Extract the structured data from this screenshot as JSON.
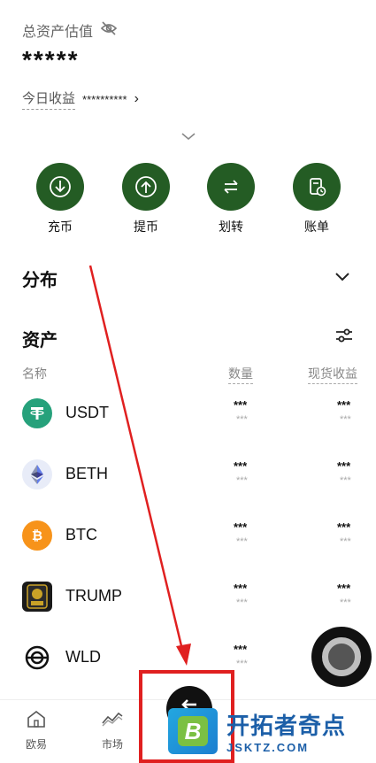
{
  "header": {
    "total_label": "总资产估值",
    "masked_value": "*****",
    "today_label": "今日收益",
    "today_masked": "**********",
    "today_chevron": "›"
  },
  "actions": [
    {
      "label": "充币",
      "icon": "deposit-icon"
    },
    {
      "label": "提币",
      "icon": "withdraw-icon"
    },
    {
      "label": "划转",
      "icon": "transfer-icon"
    },
    {
      "label": "账单",
      "icon": "bill-icon"
    }
  ],
  "distribution": {
    "title": "分布"
  },
  "assets": {
    "title": "资产",
    "columns": {
      "name": "名称",
      "quantity": "数量",
      "spot_pnl": "现货收益"
    },
    "rows": [
      {
        "name": "USDT",
        "qty": "***",
        "qty_sub": "***",
        "pnl": "***",
        "pnl_sub": "***",
        "color": "#26a17b"
      },
      {
        "name": "BETH",
        "qty": "***",
        "qty_sub": "***",
        "pnl": "***",
        "pnl_sub": "***",
        "color": "#e8ecf8"
      },
      {
        "name": "BTC",
        "qty": "***",
        "qty_sub": "***",
        "pnl": "***",
        "pnl_sub": "***",
        "color": "#f7931a"
      },
      {
        "name": "TRUMP",
        "qty": "***",
        "qty_sub": "***",
        "pnl": "***",
        "pnl_sub": "***",
        "color": "#1a1a1a"
      },
      {
        "name": "WLD",
        "qty": "***",
        "qty_sub": "***",
        "pnl": "***",
        "pnl_sub": "***",
        "color": "#ffffff"
      }
    ]
  },
  "tabbar": {
    "tabs": [
      {
        "label": "欧易",
        "icon": "home-icon"
      },
      {
        "label": "市场",
        "icon": "market-icon"
      }
    ]
  },
  "watermark": {
    "logo_letter": "B",
    "title": "开拓者奇点",
    "domain": "JSKTZ.COM"
  },
  "colors": {
    "accent_green": "#245c24",
    "annotation_red": "#e02020"
  }
}
